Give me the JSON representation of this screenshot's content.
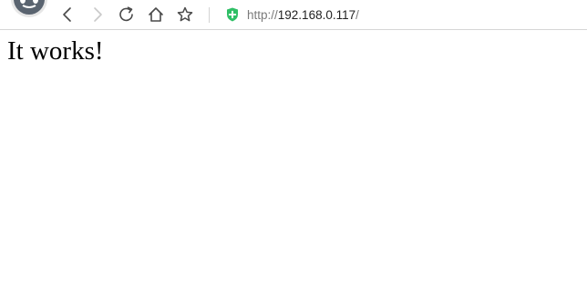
{
  "browser": {
    "address_scheme": "http://",
    "address_host": "192.168.0.117",
    "address_trail": "/",
    "security_color": "#2fbf66",
    "icons": {
      "logo": "browser-logo-icon",
      "back": "back-arrow-icon",
      "forward": "forward-arrow-icon",
      "reload": "reload-icon",
      "home": "home-icon",
      "favorite": "star-icon",
      "security": "shield-plus-icon"
    }
  },
  "page": {
    "heading": "It works!"
  }
}
